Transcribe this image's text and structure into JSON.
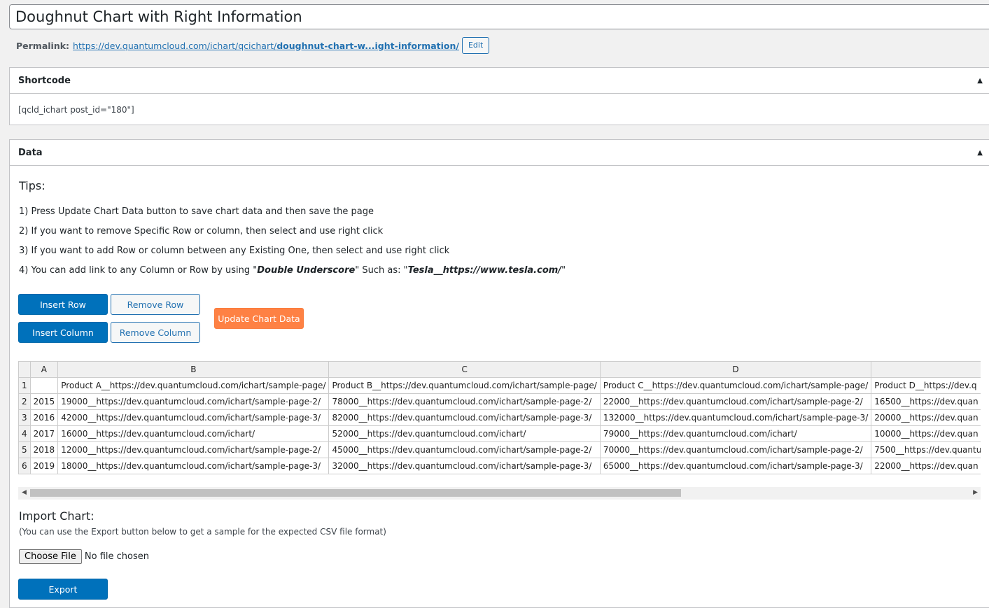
{
  "post": {
    "title": "Doughnut Chart with Right Information",
    "permalink_label": "Permalink:",
    "permalink_url_prefix": "https://dev.quantumcloud.com/ichart/qcichart/",
    "permalink_url_slug": "doughnut-chart-w...ight-information/",
    "edit_label": "Edit"
  },
  "shortcode_box": {
    "title": "Shortcode",
    "value": "[qcld_ichart post_id=\"180\"]"
  },
  "data_box": {
    "title": "Data",
    "tips_title": "Tips:",
    "tip1": "1) Press Update Chart Data button to save chart data and then save the page",
    "tip2": "2) If you want to remove Specific Row or column, then select and use right click",
    "tip3": "3) If you want to add Row or column between any Existing One, then select and use right click",
    "tip4_prefix": "4) You can add link to any Column or Row by using \"",
    "tip4_em1": "Double Underscore",
    "tip4_mid": "\" Such as: \"",
    "tip4_em2": "Tesla__https://www.tesla.com/",
    "tip4_suffix": "\"",
    "buttons": {
      "insert_row": "Insert Row",
      "remove_row": "Remove Row",
      "insert_column": "Insert Column",
      "remove_column": "Remove Column",
      "update_chart": "Update Chart Data"
    },
    "grid": {
      "col_headers": [
        "A",
        "B",
        "C",
        "D",
        ""
      ],
      "rows": [
        [
          "1",
          "",
          "Product A__https://dev.quantumcloud.com/ichart/sample-page/",
          "Product B__https://dev.quantumcloud.com/ichart/sample-page/",
          "Product C__https://dev.quantumcloud.com/ichart/sample-page/",
          "Product D__https://dev.q"
        ],
        [
          "2",
          "2015",
          "19000__https://dev.quantumcloud.com/ichart/sample-page-2/",
          "78000__https://dev.quantumcloud.com/ichart/sample-page-2/",
          "22000__https://dev.quantumcloud.com/ichart/sample-page-2/",
          "16500__https://dev.quan"
        ],
        [
          "3",
          "2016",
          "42000__https://dev.quantumcloud.com/ichart/sample-page-3/",
          "82000__https://dev.quantumcloud.com/ichart/sample-page-3/",
          "132000__https://dev.quantumcloud.com/ichart/sample-page-3/",
          "20000__https://dev.quan"
        ],
        [
          "4",
          "2017",
          "16000__https://dev.quantumcloud.com/ichart/",
          "52000__https://dev.quantumcloud.com/ichart/",
          "79000__https://dev.quantumcloud.com/ichart/",
          "10000__https://dev.quan"
        ],
        [
          "5",
          "2018",
          "12000__https://dev.quantumcloud.com/ichart/sample-page-2/",
          "45000__https://dev.quantumcloud.com/ichart/sample-page-2/",
          "70000__https://dev.quantumcloud.com/ichart/sample-page-2/",
          "7500__https://dev.quantu"
        ],
        [
          "6",
          "2019",
          "18000__https://dev.quantumcloud.com/ichart/sample-page-3/",
          "32000__https://dev.quantumcloud.com/ichart/sample-page-3/",
          "65000__https://dev.quantumcloud.com/ichart/sample-page-3/",
          "22000__https://dev.quan"
        ]
      ]
    },
    "import_title": "Import Chart:",
    "import_note": "(You can use the Export button below to get a sample for the expected CSV file format)",
    "choose_file_label": "Choose File",
    "no_file_label": "No file chosen",
    "export_label": "Export"
  },
  "colors": {
    "primary_blue": "#0071bb",
    "orange": "#fe8144",
    "link_blue": "#2271b1"
  }
}
